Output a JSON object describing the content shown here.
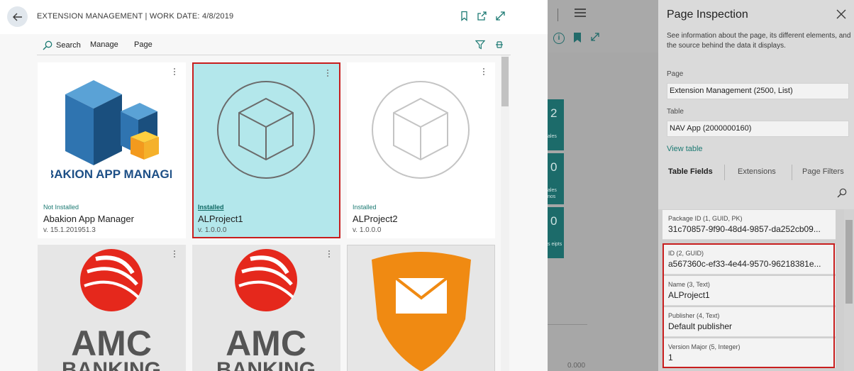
{
  "header": {
    "title": "EXTENSION MANAGEMENT | WORK DATE: 4/8/2019",
    "icons": [
      "back-arrow-icon",
      "bookmark-icon",
      "open-new-window-icon",
      "expand-icon"
    ]
  },
  "toolbar": {
    "search_label": "Search",
    "manage_label": "Manage",
    "page_label": "Page",
    "icons": [
      "search-icon",
      "filter-icon",
      "pin-icon"
    ]
  },
  "tiles": [
    {
      "status": "Not Installed",
      "name": "Abakion App Manager",
      "version": "v. 15.1.201951.3",
      "logo_text": "ABAKION APP MANAGER"
    },
    {
      "status": "Installed",
      "name": "ALProject1",
      "version": "v. 1.0.0.0",
      "selected": true
    },
    {
      "status": "Installed",
      "name": "ALProject2",
      "version": "v. 1.0.0.0"
    },
    {
      "logo_text": "AMC BANKING"
    },
    {
      "logo_text": "AMC BANKING"
    },
    {
      "logo_text": "email-envelope"
    }
  ],
  "background": {
    "tiles": [
      {
        "number": "2",
        "label": "ales"
      },
      {
        "number": "0",
        "label": "ales nos"
      },
      {
        "number": "0",
        "label": "s eipts"
      }
    ],
    "amount": "0.000"
  },
  "inspection": {
    "title": "Page Inspection",
    "description": "See information about the page, its different elements, and the source behind the data it displays.",
    "page_label": "Page",
    "page_value": "Extension Management (2500, List)",
    "table_label": "Table",
    "table_value": "NAV App (2000000160)",
    "view_table": "View table",
    "tabs": [
      "Table Fields",
      "Extensions",
      "Page Filters"
    ],
    "fields": [
      {
        "label": "Package ID (1, GUID, PK)",
        "value": "31c70857-9f90-48d4-9857-da252cb09..."
      },
      {
        "label": "ID (2, GUID)",
        "value": "a567360c-ef33-4e44-9570-96218381e..."
      },
      {
        "label": "Name (3, Text)",
        "value": "ALProject1"
      },
      {
        "label": "Publisher (4, Text)",
        "value": "Default publisher"
      },
      {
        "label": "Version Major (5, Integer)",
        "value": "1"
      }
    ]
  },
  "colors": {
    "accent": "#1c7a73",
    "selection": "#b3e7eb",
    "highlight_border": "#c81e1e"
  }
}
